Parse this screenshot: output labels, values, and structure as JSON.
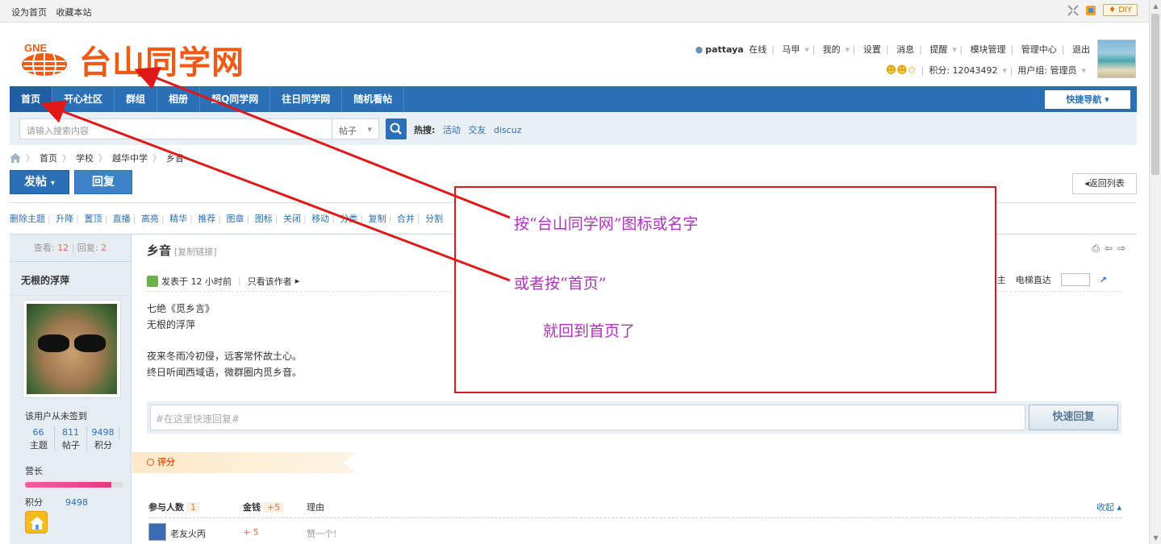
{
  "topbar": {
    "set_home": "设为首页",
    "bookmark": "收藏本站",
    "diy": "DIY"
  },
  "header": {
    "logo_text": "台山同学网",
    "logo_mark_text": "GNE"
  },
  "user": {
    "name": "pattaya",
    "status": "在线",
    "horse": "马甲",
    "mine": "我的",
    "settings": "设置",
    "messages": "消息",
    "remind": "提醒",
    "modules": "模块管理",
    "admin": "管理中心",
    "logout": "退出",
    "credits": "积分: 12043492",
    "group": "用户组: 管理员"
  },
  "nav": {
    "items": [
      "首页",
      "开心社区",
      "群组",
      "相册",
      "超Q同学网",
      "往日同学网",
      "随机看帖"
    ],
    "quick_nav": "快捷导航"
  },
  "search": {
    "placeholder": "请输入搜索内容",
    "type": "帖子",
    "hot_label": "热搜:",
    "hot_items": [
      "活动",
      "交友",
      "discuz"
    ]
  },
  "breadcrumb": [
    "首页",
    "学校",
    "越华中学",
    "乡音"
  ],
  "actions": {
    "post": "发帖",
    "reply": "回复",
    "back": "返回列表"
  },
  "mod_tools": [
    "删除主题",
    "升降",
    "置顶",
    "直播",
    "高亮",
    "精华",
    "推荐",
    "图章",
    "图标",
    "关闭",
    "移动",
    "分类",
    "复制",
    "合并",
    "分割"
  ],
  "sidebar": {
    "views_label": "查看:",
    "views": "12",
    "replies_label": "回复:",
    "replies": "2",
    "author": "无根的浮萍",
    "sign": "该用户从未签到",
    "stats": [
      {
        "value": "66",
        "label": "主题"
      },
      {
        "value": "811",
        "label": "帖子"
      },
      {
        "value": "9498",
        "label": "积分"
      }
    ],
    "rank": "营长",
    "rank_progress": 0.88,
    "points_label": "积分",
    "points": "9498"
  },
  "post": {
    "title": "乡音",
    "copy_link": "[复制链接]",
    "posted": "发表于 12 小时前",
    "only_author": "只看该作者",
    "floor_host": "楼主",
    "jump": "电梯直达",
    "lines": [
      "七绝《觅乡言》",
      "无根的浮萍",
      "",
      "夜来冬雨冷初侵，远客常怀故土心。",
      "终日听闻西域语，微群圈内觅乡音。"
    ]
  },
  "quick_reply": {
    "placeholder": "#在这里快速回复#",
    "button": "快速回复"
  },
  "rating": {
    "tag": "评分",
    "participants_label": "参与人数",
    "participants": "1",
    "money_label": "金钱",
    "money": "+5",
    "reason_label": "理由",
    "collapse": "收起",
    "rows": [
      {
        "user": "老友火丙",
        "value": "+ 5",
        "reason": "赞一个!"
      }
    ]
  },
  "annotation": {
    "line1": "按“台山同学网”图标或名字",
    "line2": "或者按“首页”",
    "line3": "就回到首页了"
  },
  "colors": {
    "nav_blue": "#2b6fb6",
    "logo_orange": "#f05a14",
    "annot_red": "#e01818",
    "annot_text": "#b030c0"
  }
}
